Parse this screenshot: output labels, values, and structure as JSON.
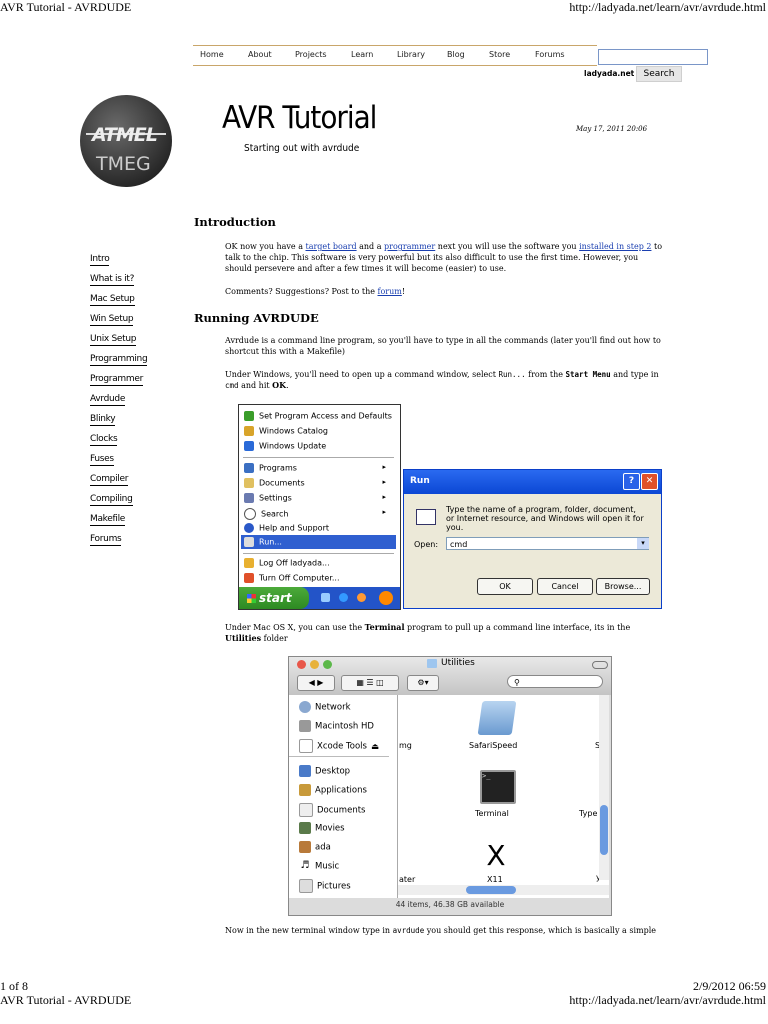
{
  "print_header": {
    "left": "AVR Tutorial - AVRDUDE",
    "right": "http://ladyada.net/learn/avr/avrdude.html"
  },
  "print_footer": {
    "page": "1 of 8",
    "datetime": "2/9/2012 06:59"
  },
  "nav": {
    "items": [
      "Home",
      "About",
      "Projects",
      "Learn",
      "Library",
      "Blog",
      "Store",
      "Forums"
    ],
    "site": "ladyada.net",
    "search_label": "Search",
    "search_value": ""
  },
  "logo": {
    "text1": "ATMEL",
    "text2": "TMEG"
  },
  "hero": {
    "title": "AVR Tutorial",
    "subtitle": "Starting out with avrdude",
    "date": "May 17, 2011 20:06"
  },
  "sidebar": {
    "items": [
      "Intro",
      "What is it?",
      "Mac Setup",
      "Win Setup",
      "Unix Setup",
      "Programming",
      "Programmer",
      "Avrdude",
      "Blinky",
      "Clocks",
      "Fuses",
      "Compiler",
      "Compiling",
      "Makefile",
      "Forums"
    ]
  },
  "intro": {
    "heading": "Introduction",
    "p1_a": "OK now you have a ",
    "p1_link1": "target board",
    "p1_b": " and a ",
    "p1_link2": "programmer",
    "p1_c": " next you will use the software you ",
    "p1_link3": "installed in step 2",
    "p1_d": " to talk to the chip. This software is very powerful but its also difficult to use the first time. However, you should persevere and after a few times it will become (easier) to use.",
    "p2_a": "Comments? Suggestions? Post to the ",
    "p2_link": "forum",
    "p2_b": "!"
  },
  "running": {
    "heading": "Running AVRDUDE",
    "p1": "Avrdude is a command line program, so you'll have to type in all the commands (later you'll find out how to shortcut this with a Makefile)",
    "p2_a": "Under Windows, you'll need to open up a command window, select ",
    "p2_code1": "Run...",
    "p2_b": " from the ",
    "p2_code2": "Start Menu",
    "p2_c": " and type in ",
    "p2_code3": "cmd",
    "p2_d": " and hit ",
    "p2_bold": "OK",
    "p2_e": "."
  },
  "startmenu": {
    "top_items": [
      "Set Program Access and Defaults",
      "Windows Catalog",
      "Windows Update"
    ],
    "items": [
      {
        "label": "Programs",
        "arrow": "▸"
      },
      {
        "label": "Documents",
        "arrow": "▸"
      },
      {
        "label": "Settings",
        "arrow": "▸"
      },
      {
        "label": "Search",
        "arrow": "▸"
      },
      {
        "label": "Help and Support",
        "arrow": ""
      },
      {
        "label": "Run...",
        "arrow": ""
      }
    ],
    "bottom_items": [
      "Log Off ladyada...",
      "Turn Off Computer..."
    ],
    "start_label": "start"
  },
  "run_dialog": {
    "title": "Run",
    "help": "?",
    "close": "✕",
    "desc": "Type the name of a program, folder, document, or Internet resource, and Windows will open it for you.",
    "open_label": "Open:",
    "open_value": "cmd",
    "ok": "OK",
    "cancel": "Cancel",
    "browse": "Browse..."
  },
  "mac": {
    "p_a": "Under Mac OS X, you can use the ",
    "p_bold1": "Terminal",
    "p_b": " program to pull up a command line interface, its in the ",
    "p_bold2": "Utilities",
    "p_c": " folder"
  },
  "finder": {
    "title": "Utilities",
    "sidebar_top": [
      "Network",
      "Macintosh HD",
      "Xcode Tools"
    ],
    "sidebar_places": [
      "Desktop",
      "Applications",
      "Documents",
      "Movies",
      "ada",
      "Music",
      "Pictures"
    ],
    "items": [
      "SafariSpeed",
      "Terminal",
      "X11"
    ],
    "partial_labels": [
      "mg",
      "S",
      "Type",
      "ater",
      "y"
    ],
    "status": "44 items, 46.38 GB available"
  },
  "last_line": {
    "a": "Now in the new terminal window type in ",
    "code": "avrdude",
    "b": " you should get this response, which is basically a simple"
  },
  "colors": {
    "link": "#1a3fb0",
    "xp_blue": "#0b47d4",
    "xp_green": "#3a9d2a",
    "nav_border": "#c9a66a"
  }
}
